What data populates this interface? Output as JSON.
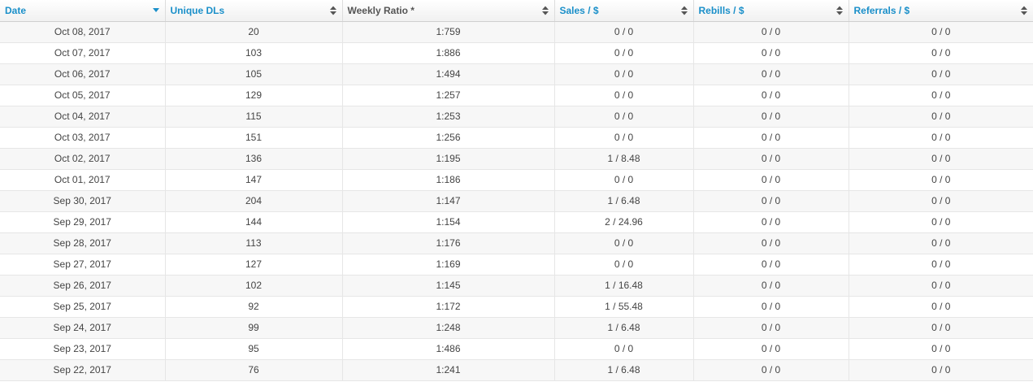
{
  "table": {
    "columns": [
      {
        "key": "date",
        "label": "Date",
        "sort": "desc",
        "active": true
      },
      {
        "key": "unique_dls",
        "label": "Unique DLs",
        "sort": "both",
        "active": true
      },
      {
        "key": "weekly_ratio",
        "label": "Weekly Ratio *",
        "sort": "both",
        "active": false
      },
      {
        "key": "sales",
        "label": "Sales / $",
        "sort": "both",
        "active": true
      },
      {
        "key": "rebills",
        "label": "Rebills / $",
        "sort": "both",
        "active": true
      },
      {
        "key": "referrals",
        "label": "Referrals / $",
        "sort": "both",
        "active": true
      }
    ],
    "rows": [
      [
        "Oct 08, 2017",
        "20",
        "1:759",
        "0 / 0",
        "0 / 0",
        "0 / 0"
      ],
      [
        "Oct 07, 2017",
        "103",
        "1:886",
        "0 / 0",
        "0 / 0",
        "0 / 0"
      ],
      [
        "Oct 06, 2017",
        "105",
        "1:494",
        "0 / 0",
        "0 / 0",
        "0 / 0"
      ],
      [
        "Oct 05, 2017",
        "129",
        "1:257",
        "0 / 0",
        "0 / 0",
        "0 / 0"
      ],
      [
        "Oct 04, 2017",
        "115",
        "1:253",
        "0 / 0",
        "0 / 0",
        "0 / 0"
      ],
      [
        "Oct 03, 2017",
        "151",
        "1:256",
        "0 / 0",
        "0 / 0",
        "0 / 0"
      ],
      [
        "Oct 02, 2017",
        "136",
        "1:195",
        "1 / 8.48",
        "0 / 0",
        "0 / 0"
      ],
      [
        "Oct 01, 2017",
        "147",
        "1:186",
        "0 / 0",
        "0 / 0",
        "0 / 0"
      ],
      [
        "Sep 30, 2017",
        "204",
        "1:147",
        "1 / 6.48",
        "0 / 0",
        "0 / 0"
      ],
      [
        "Sep 29, 2017",
        "144",
        "1:154",
        "2 / 24.96",
        "0 / 0",
        "0 / 0"
      ],
      [
        "Sep 28, 2017",
        "113",
        "1:176",
        "0 / 0",
        "0 / 0",
        "0 / 0"
      ],
      [
        "Sep 27, 2017",
        "127",
        "1:169",
        "0 / 0",
        "0 / 0",
        "0 / 0"
      ],
      [
        "Sep 26, 2017",
        "102",
        "1:145",
        "1 / 16.48",
        "0 / 0",
        "0 / 0"
      ],
      [
        "Sep 25, 2017",
        "92",
        "1:172",
        "1 / 55.48",
        "0 / 0",
        "0 / 0"
      ],
      [
        "Sep 24, 2017",
        "99",
        "1:248",
        "1 / 6.48",
        "0 / 0",
        "0 / 0"
      ],
      [
        "Sep 23, 2017",
        "95",
        "1:486",
        "0 / 0",
        "0 / 0",
        "0 / 0"
      ],
      [
        "Sep 22, 2017",
        "76",
        "1:241",
        "1 / 6.48",
        "0 / 0",
        "0 / 0"
      ]
    ]
  },
  "colors": {
    "active_header": "#1a8fc9",
    "inactive_header": "#555555",
    "sort_desc_icon": "#1a8fc9",
    "sort_both_icon": "#555555"
  },
  "icons": {
    "sort_desc": "sort-desc-icon",
    "sort_both": "sort-both-icon"
  }
}
